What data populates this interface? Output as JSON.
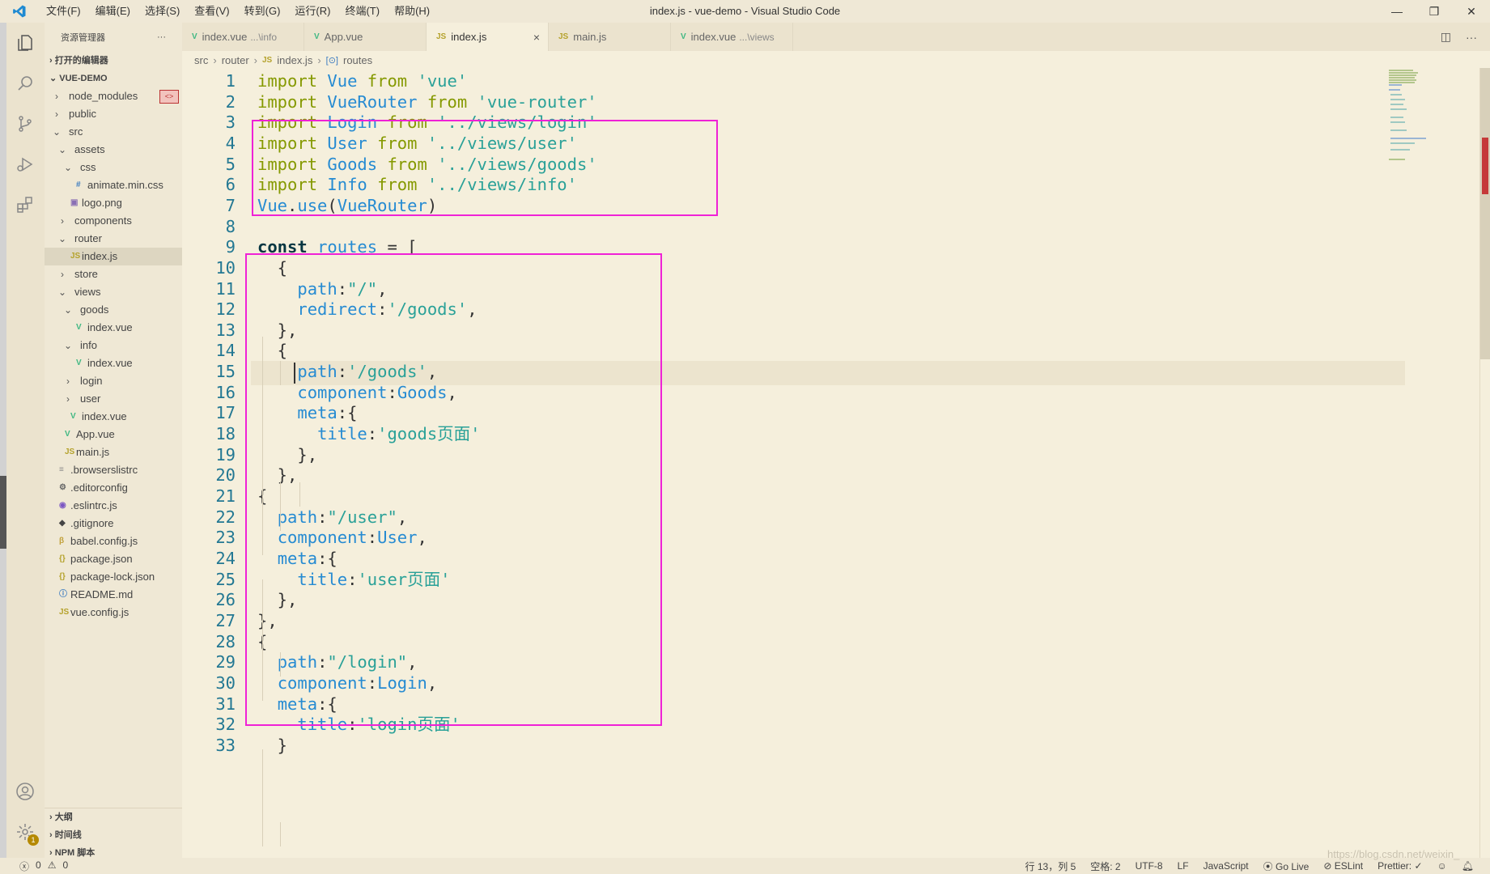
{
  "app": {
    "window_title": "index.js - vue-demo - Visual Studio Code",
    "menu": [
      "文件(F)",
      "编辑(E)",
      "选择(S)",
      "查看(V)",
      "转到(G)",
      "运行(R)",
      "终端(T)",
      "帮助(H)"
    ]
  },
  "sidebar": {
    "title": "资源管理器",
    "more": "···",
    "open_editors": "打开的编辑器",
    "project": "VUE-DEMO",
    "tree": [
      {
        "label": "node_modules",
        "depth": 0,
        "chevron": "›",
        "icon": ""
      },
      {
        "label": "public",
        "depth": 0,
        "chevron": "›",
        "icon": ""
      },
      {
        "label": "src",
        "depth": 0,
        "chevron": "⌄",
        "icon": ""
      },
      {
        "label": "assets",
        "depth": 1,
        "chevron": "⌄",
        "icon": ""
      },
      {
        "label": "css",
        "depth": 2,
        "chevron": "⌄",
        "icon": ""
      },
      {
        "label": "animate.min.css",
        "depth": 3,
        "chevron": "",
        "icon": "#"
      },
      {
        "label": "logo.png",
        "depth": 2,
        "chevron": "",
        "icon": "▣"
      },
      {
        "label": "components",
        "depth": 1,
        "chevron": "›",
        "icon": ""
      },
      {
        "label": "router",
        "depth": 1,
        "chevron": "⌄",
        "icon": ""
      },
      {
        "label": "index.js",
        "depth": 2,
        "chevron": "",
        "icon": "JS"
      },
      {
        "label": "store",
        "depth": 1,
        "chevron": "›",
        "icon": ""
      },
      {
        "label": "views",
        "depth": 1,
        "chevron": "⌄",
        "icon": ""
      },
      {
        "label": "goods",
        "depth": 2,
        "chevron": "⌄",
        "icon": ""
      },
      {
        "label": "index.vue",
        "depth": 3,
        "chevron": "",
        "icon": "V"
      },
      {
        "label": "info",
        "depth": 2,
        "chevron": "⌄",
        "icon": ""
      },
      {
        "label": "index.vue",
        "depth": 3,
        "chevron": "",
        "icon": "V"
      },
      {
        "label": "login",
        "depth": 2,
        "chevron": "›",
        "icon": ""
      },
      {
        "label": "user",
        "depth": 2,
        "chevron": "›",
        "icon": ""
      },
      {
        "label": "index.vue",
        "depth": 2,
        "chevron": "",
        "icon": "V"
      },
      {
        "label": "App.vue",
        "depth": 1,
        "chevron": "",
        "icon": "V"
      },
      {
        "label": "main.js",
        "depth": 1,
        "chevron": "",
        "icon": "JS"
      },
      {
        "label": ".browserslistrc",
        "depth": 0,
        "chevron": "",
        "icon": "≡"
      },
      {
        "label": ".editorconfig",
        "depth": 0,
        "chevron": "",
        "icon": "⚙"
      },
      {
        "label": ".eslintrc.js",
        "depth": 0,
        "chevron": "",
        "icon": "◉"
      },
      {
        "label": ".gitignore",
        "depth": 0,
        "chevron": "",
        "icon": "◆"
      },
      {
        "label": "babel.config.js",
        "depth": 0,
        "chevron": "",
        "icon": "β"
      },
      {
        "label": "package.json",
        "depth": 0,
        "chevron": "",
        "icon": "{}"
      },
      {
        "label": "package-lock.json",
        "depth": 0,
        "chevron": "",
        "icon": "{}"
      },
      {
        "label": "README.md",
        "depth": 0,
        "chevron": "",
        "icon": "ⓘ"
      },
      {
        "label": "vue.config.js",
        "depth": 0,
        "chevron": "",
        "icon": "JS"
      }
    ],
    "node_modules_badge": "<>",
    "bottom": [
      "大纲",
      "时间线",
      "NPM 脚本"
    ],
    "settings_badge": "1"
  },
  "tabs": [
    {
      "icon": "V",
      "label": "index.vue",
      "hint": "...\\info",
      "active": false
    },
    {
      "icon": "V",
      "label": "App.vue",
      "hint": "",
      "active": false
    },
    {
      "icon": "JS",
      "label": "index.js",
      "hint": "",
      "active": true
    },
    {
      "icon": "JS",
      "label": "main.js",
      "hint": "",
      "active": false
    },
    {
      "icon": "V",
      "label": "index.vue",
      "hint": "...\\views",
      "active": false
    }
  ],
  "tab_close": "×",
  "breadcrumb": [
    "src",
    "router",
    "index.js",
    "routes"
  ],
  "code_lines": [
    [
      [
        "kw",
        "import "
      ],
      [
        "id",
        "Vue "
      ],
      [
        "kw",
        "from "
      ],
      [
        "str",
        "'vue'"
      ]
    ],
    [
      [
        "kw",
        "import "
      ],
      [
        "id",
        "VueRouter "
      ],
      [
        "kw",
        "from "
      ],
      [
        "str",
        "'vue-router'"
      ]
    ],
    [
      [
        "kw",
        "import "
      ],
      [
        "id",
        "Login "
      ],
      [
        "kw",
        "from "
      ],
      [
        "str",
        "'../views/login'"
      ]
    ],
    [
      [
        "kw",
        "import "
      ],
      [
        "id",
        "User "
      ],
      [
        "kw",
        "from "
      ],
      [
        "str",
        "'../views/user'"
      ]
    ],
    [
      [
        "kw",
        "import "
      ],
      [
        "id",
        "Goods "
      ],
      [
        "kw",
        "from "
      ],
      [
        "str",
        "'../views/goods'"
      ]
    ],
    [
      [
        "kw",
        "import "
      ],
      [
        "id",
        "Info "
      ],
      [
        "kw",
        "from "
      ],
      [
        "str",
        "'../views/info'"
      ]
    ],
    [
      [
        "id",
        "Vue"
      ],
      [
        "pn",
        "."
      ],
      [
        "id",
        "use"
      ],
      [
        "pn",
        "("
      ],
      [
        "id",
        "VueRouter"
      ],
      [
        "pn",
        ")"
      ]
    ],
    [],
    [
      [
        "ctl",
        "const "
      ],
      [
        "id",
        "routes "
      ],
      [
        "pn",
        "= ["
      ]
    ],
    [
      [
        "pn",
        "  {"
      ]
    ],
    [
      [
        "pn",
        "    "
      ],
      [
        "id",
        "path"
      ],
      [
        "pn",
        ":"
      ],
      [
        "str",
        "\"/\""
      ],
      [
        "pn",
        ","
      ]
    ],
    [
      [
        "pn",
        "    "
      ],
      [
        "id",
        "redirect"
      ],
      [
        "pn",
        ":"
      ],
      [
        "str",
        "'/goods'"
      ],
      [
        "pn",
        ","
      ]
    ],
    [
      [
        "pn",
        "  },"
      ]
    ],
    [
      [
        "pn",
        "  {"
      ]
    ],
    [
      [
        "pn",
        "    "
      ],
      [
        "id",
        "path"
      ],
      [
        "pn",
        ":"
      ],
      [
        "str",
        "'/goods'"
      ],
      [
        "pn",
        ","
      ]
    ],
    [
      [
        "pn",
        "    "
      ],
      [
        "id",
        "component"
      ],
      [
        "pn",
        ":"
      ],
      [
        "id",
        "Goods"
      ],
      [
        "pn",
        ","
      ]
    ],
    [
      [
        "pn",
        "    "
      ],
      [
        "id",
        "meta"
      ],
      [
        "pn",
        ":{"
      ]
    ],
    [
      [
        "pn",
        "      "
      ],
      [
        "id",
        "title"
      ],
      [
        "pn",
        ":"
      ],
      [
        "str",
        "'goods页面'"
      ]
    ],
    [
      [
        "pn",
        "    },"
      ]
    ],
    [
      [
        "pn",
        "  },"
      ]
    ],
    [
      [
        "pn",
        "{"
      ]
    ],
    [
      [
        "pn",
        "  "
      ],
      [
        "id",
        "path"
      ],
      [
        "pn",
        ":"
      ],
      [
        "str",
        "\"/user\""
      ],
      [
        "pn",
        ","
      ]
    ],
    [
      [
        "pn",
        "  "
      ],
      [
        "id",
        "component"
      ],
      [
        "pn",
        ":"
      ],
      [
        "id",
        "User"
      ],
      [
        "pn",
        ","
      ]
    ],
    [
      [
        "pn",
        "  "
      ],
      [
        "id",
        "meta"
      ],
      [
        "pn",
        ":{"
      ]
    ],
    [
      [
        "pn",
        "    "
      ],
      [
        "id",
        "title"
      ],
      [
        "pn",
        ":"
      ],
      [
        "str",
        "'user页面'"
      ]
    ],
    [
      [
        "pn",
        "  },"
      ]
    ],
    [
      [
        "pn",
        "},"
      ]
    ],
    [
      [
        "pn",
        "{"
      ]
    ],
    [
      [
        "pn",
        "  "
      ],
      [
        "id",
        "path"
      ],
      [
        "pn",
        ":"
      ],
      [
        "str",
        "\"/login\""
      ],
      [
        "pn",
        ","
      ]
    ],
    [
      [
        "pn",
        "  "
      ],
      [
        "id",
        "component"
      ],
      [
        "pn",
        ":"
      ],
      [
        "id",
        "Login"
      ],
      [
        "pn",
        ","
      ]
    ],
    [
      [
        "pn",
        "  "
      ],
      [
        "id",
        "meta"
      ],
      [
        "pn",
        ":{"
      ]
    ],
    [
      [
        "pn",
        "    "
      ],
      [
        "id",
        "title"
      ],
      [
        "pn",
        ":"
      ],
      [
        "str",
        "'login页面'"
      ]
    ],
    [
      [
        "pn",
        "  }"
      ]
    ]
  ],
  "status": {
    "errors": "0",
    "warnings": "0",
    "position": "行 13，列 5",
    "spaces": "空格: 2",
    "encoding": "UTF-8",
    "eol": "LF",
    "language": "JavaScript",
    "golive": "Go Live",
    "eslint": "ESLint",
    "prettier": "Prettier: ✓"
  },
  "watermark": "https://blog.csdn.net/weixin_"
}
